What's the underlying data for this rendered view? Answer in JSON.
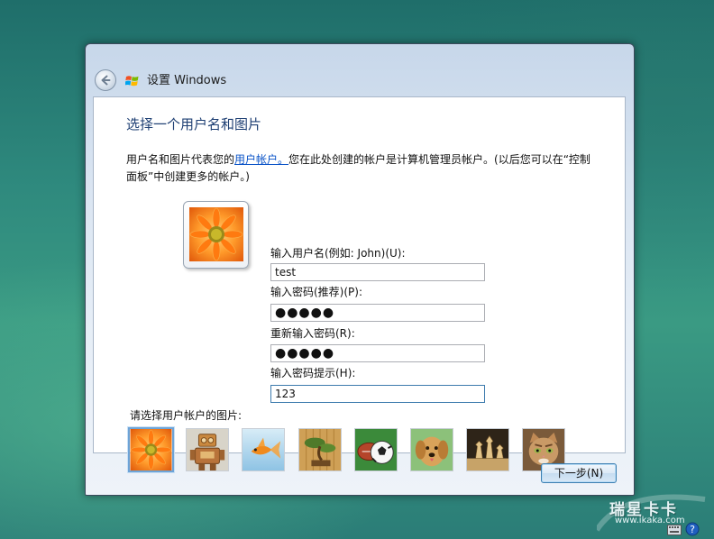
{
  "window": {
    "title": "设置 Windows"
  },
  "page": {
    "heading": "选择一个用户名和图片",
    "description_pre": "用户名和图片代表您的",
    "description_link": "用户帐户。",
    "description_post": "您在此处创建的帐户是计算机管理员帐户。(以后您可以在“控制面板”中创建更多的帐户。)"
  },
  "form": {
    "username_label": "输入用户名(例如: John)(U):",
    "username_value": "test",
    "password_label": "输入密码(推荐)(P):",
    "password_value": "●●●●●",
    "confirm_label": "重新输入密码(R):",
    "confirm_value": "●●●●●",
    "hint_label": "输入密码提示(H):",
    "hint_value": "123"
  },
  "pictures": {
    "label": "请选择用户帐户的图片:",
    "items": [
      "flower-picture",
      "robot-picture",
      "goldfish-picture",
      "bonsai-picture",
      "soccer-ball-picture",
      "dog-picture",
      "chess-picture",
      "kitten-picture"
    ],
    "selected_index": 0
  },
  "footer": {
    "next_label": "下一步(N)"
  },
  "watermark": {
    "brand": "瑞星卡卡",
    "url": "www.ikaka.com"
  },
  "colors": {
    "heading": "#1e3f73",
    "link": "#0b54c8",
    "selection": "#6da4d8"
  }
}
